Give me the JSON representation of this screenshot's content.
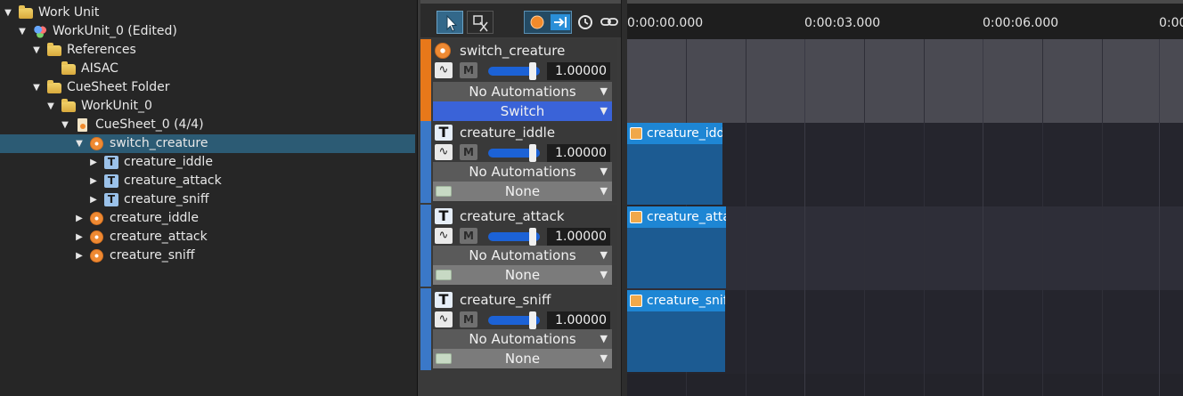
{
  "tree": {
    "items": [
      {
        "label": "Work Unit",
        "icon": "folder-icon",
        "depth": 0,
        "expanded": true
      },
      {
        "label": "WorkUnit_0 (Edited)",
        "icon": "workunit-icon",
        "depth": 1,
        "expanded": true
      },
      {
        "label": "References",
        "icon": "folder-icon",
        "depth": 2,
        "expanded": true
      },
      {
        "label": "AISAC",
        "icon": "folder-icon",
        "depth": 3,
        "expanded": false
      },
      {
        "label": "CueSheet Folder",
        "icon": "folder-icon",
        "depth": 2,
        "expanded": true
      },
      {
        "label": "WorkUnit_0",
        "icon": "folder-icon",
        "depth": 3,
        "expanded": true
      },
      {
        "label": "CueSheet_0 (4/4)",
        "icon": "cuesheet-icon",
        "depth": 4,
        "expanded": true
      },
      {
        "label": "switch_creature",
        "icon": "cue-icon",
        "depth": 5,
        "expanded": true,
        "selected": true
      },
      {
        "label": "creature_iddle",
        "icon": "track-icon",
        "depth": 6,
        "expanded": false
      },
      {
        "label": "creature_attack",
        "icon": "track-icon",
        "depth": 6,
        "expanded": false
      },
      {
        "label": "creature_sniff",
        "icon": "track-icon",
        "depth": 6,
        "expanded": false
      },
      {
        "label": "creature_iddle",
        "icon": "cue-icon",
        "depth": 5,
        "expanded": false
      },
      {
        "label": "creature_attack",
        "icon": "cue-icon",
        "depth": 5,
        "expanded": false
      },
      {
        "label": "creature_sniff",
        "icon": "cue-icon",
        "depth": 5,
        "expanded": false
      }
    ]
  },
  "toolbar": {
    "select_icon": "cursor-arrow-icon",
    "scissor_icon": "scissor-icon",
    "record_icon": "orange-dot-icon",
    "jump_icon": "arrow-right-bar-icon",
    "clock_icon": "clock-icon",
    "link_icon": "link-icon"
  },
  "tracks": [
    {
      "name": "switch_creature",
      "icon": "cue-icon",
      "volume": "1.00000",
      "mute_label": "M",
      "automation": "No Automations",
      "selector": "Switch",
      "stripe_color": "#e8781a"
    },
    {
      "name": "creature_iddle",
      "icon": "track-T-icon",
      "volume": "1.00000",
      "mute_label": "M",
      "automation": "No Automations",
      "selector": "None",
      "stripe_color": "#3a78c8"
    },
    {
      "name": "creature_attack",
      "icon": "track-T-icon",
      "volume": "1.00000",
      "mute_label": "M",
      "automation": "No Automations",
      "selector": "None",
      "stripe_color": "#3a78c8"
    },
    {
      "name": "creature_sniff",
      "icon": "track-T-icon",
      "volume": "1.00000",
      "mute_label": "M",
      "automation": "No Automations",
      "selector": "None",
      "stripe_color": "#3a78c8"
    }
  ],
  "volume_level": 0.92,
  "ruler": {
    "ticks": [
      "0:00:00.000",
      "0:00:03.000",
      "0:00:06.000",
      "0:00"
    ]
  },
  "clips": [
    {
      "label": "creature_iddle",
      "track": 1
    },
    {
      "label": "creature_attack",
      "track": 2
    },
    {
      "label": "creature_sniff",
      "track": 3
    }
  ],
  "colors": {
    "selection": "#2c5b74",
    "clip_header": "#1e86d4",
    "clip_body": "#1c5b92",
    "switch_dropdown": "#3a63d8",
    "cue_stripe": "#e8781a",
    "track_stripe": "#3a78c8"
  }
}
